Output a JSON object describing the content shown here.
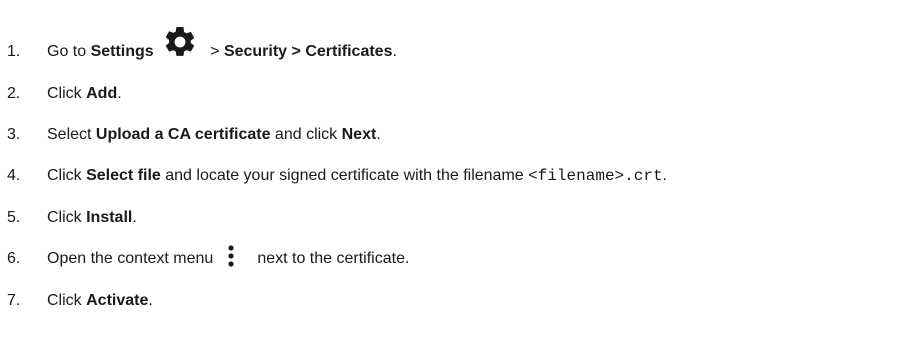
{
  "steps": [
    {
      "number": "1.",
      "parts": {
        "t1": "Go to ",
        "b1": "Settings",
        "icon": "gear-icon",
        "t2": " > ",
        "b2": "Security > Certificates",
        "t3": "."
      }
    },
    {
      "number": "2.",
      "parts": {
        "t1": "Click ",
        "b1": "Add",
        "t2": "."
      }
    },
    {
      "number": "3.",
      "parts": {
        "t1": "Select ",
        "b1": "Upload a CA certificate",
        "t2": " and click ",
        "b2": "Next",
        "t3": "."
      }
    },
    {
      "number": "4.",
      "parts": {
        "t1": "Click ",
        "b1": "Select file",
        "t2": " and locate your signed certificate with the filename ",
        "code": "<filename>.crt",
        "t3": "."
      }
    },
    {
      "number": "5.",
      "parts": {
        "t1": "Click ",
        "b1": "Install",
        "t2": "."
      }
    },
    {
      "number": "6.",
      "parts": {
        "t1": "Open the context menu",
        "icon": "more-vertical-icon",
        "t2": "next to the certificate."
      }
    },
    {
      "number": "7.",
      "parts": {
        "t1": "Click ",
        "b1": "Activate",
        "t2": "."
      }
    }
  ]
}
